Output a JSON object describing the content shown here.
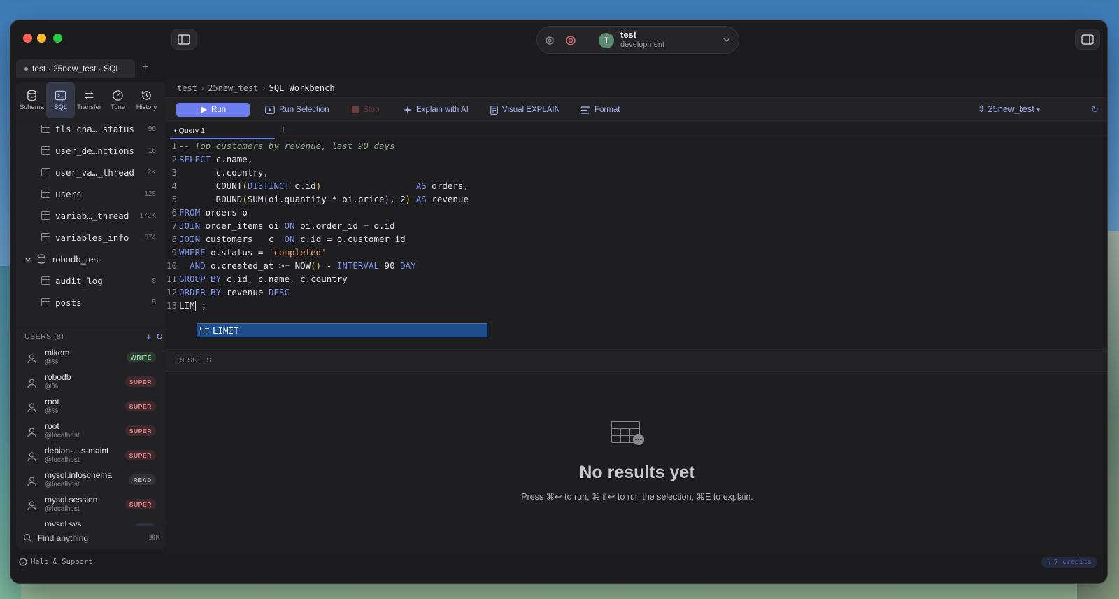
{
  "window": {
    "tab_title": "test · 25new_test · SQL",
    "tab_add": "+"
  },
  "connection": {
    "avatar_letter": "T",
    "name": "test",
    "environment": "development"
  },
  "sidebar": {
    "tools": [
      {
        "label": "Schema",
        "icon": "database-icon"
      },
      {
        "label": "SQL",
        "icon": "terminal-icon"
      },
      {
        "label": "Transfer",
        "icon": "transfer-icon"
      },
      {
        "label": "Tune",
        "icon": "gauge-icon"
      },
      {
        "label": "History",
        "icon": "history-icon"
      }
    ],
    "tables": [
      {
        "name": "tls_cha…_status",
        "count": "96"
      },
      {
        "name": "user_de…nctions",
        "count": "16"
      },
      {
        "name": "user_va…_thread",
        "count": "2K"
      },
      {
        "name": "users",
        "count": "128"
      },
      {
        "name": "variab…_thread",
        "count": "172K"
      },
      {
        "name": "variables_info",
        "count": "674"
      }
    ],
    "database": {
      "name": "robodb_test"
    },
    "db_tables": [
      {
        "name": "audit_log",
        "count": "8"
      },
      {
        "name": "posts",
        "count": "5"
      }
    ]
  },
  "users": {
    "header": "USERS  (8)",
    "list": [
      {
        "name": "mikem",
        "host": "@%",
        "role": "WRITE",
        "role_class": "write"
      },
      {
        "name": "robodb",
        "host": "@%",
        "role": "SUPER",
        "role_class": "super"
      },
      {
        "name": "root",
        "host": "@%",
        "role": "SUPER",
        "role_class": "super"
      },
      {
        "name": "root",
        "host": "@localhost",
        "role": "SUPER",
        "role_class": "super"
      },
      {
        "name": "debian-…s-maint",
        "host": "@localhost",
        "role": "SUPER",
        "role_class": "super"
      },
      {
        "name": "mysql.infoschema",
        "host": "@localhost",
        "role": "READ",
        "role_class": "read"
      },
      {
        "name": "mysql.session",
        "host": "@localhost",
        "role": "SUPER",
        "role_class": "super"
      },
      {
        "name": "mysql.sys",
        "host": "",
        "role": "DBL",
        "role_class": "dbl"
      }
    ]
  },
  "find": {
    "label": "Find anything",
    "shortcut": "⌘K"
  },
  "breadcrumb": {
    "items": [
      "test",
      "25new_test"
    ],
    "current": "SQL Workbench",
    "sep": "›"
  },
  "toolbar": {
    "run": "Run",
    "run_selection": "Run Selection",
    "stop": "Stop",
    "explain_ai": "Explain with AI",
    "visual_explain": "Visual EXPLAIN",
    "format": "Format",
    "database": "25new_test"
  },
  "query_tab": {
    "label": "• Query 1",
    "add": "+"
  },
  "editor": {
    "line_numbers": [
      "1",
      "2",
      "3",
      "4",
      "5",
      "6",
      "7",
      "8",
      "9",
      "10",
      "11",
      "12",
      "13"
    ],
    "suggestion": "LIMIT"
  },
  "results": {
    "header": "RESULTS",
    "empty_title": "No results yet",
    "empty_hint": "Press ⌘↩ to run, ⌘⇧↩ to run the selection, ⌘E to explain."
  },
  "status": {
    "help": "Help & Support",
    "credits": "7 credits"
  }
}
